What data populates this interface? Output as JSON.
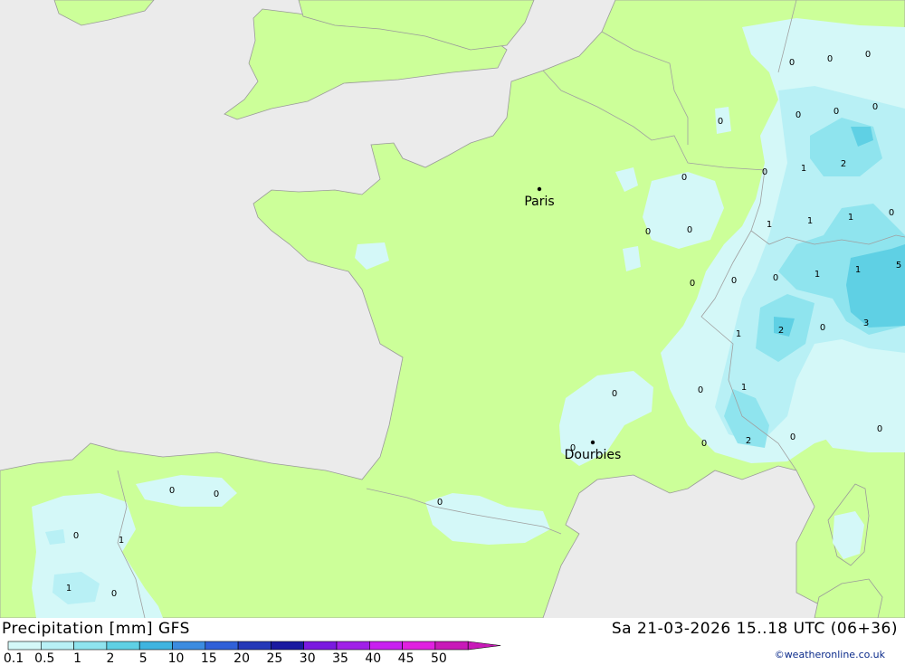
{
  "title": "Precipitation [mm] GFS",
  "valid_time": "Sa 21-03-2026 15..18 UTC (06+36)",
  "credit": "©weatheronline.co.uk",
  "colors": {
    "sea": "#ebebeb",
    "land": "#ccff99",
    "border": "#9a9a9a"
  },
  "legend": {
    "labels": [
      "0.1",
      "0.5",
      "1",
      "2",
      "5",
      "10",
      "15",
      "20",
      "25",
      "30",
      "35",
      "40",
      "45",
      "50"
    ],
    "colors": [
      "#d4f8f8",
      "#b8f0f5",
      "#8fe4ee",
      "#5fd0e4",
      "#3fb4e0",
      "#3c8ce0",
      "#3060d8",
      "#2438b8",
      "#1a1aa0",
      "#7a1ae0",
      "#a020e8",
      "#c820f0",
      "#e020e0",
      "#c81ab8"
    ]
  },
  "cities": [
    {
      "name": "Paris"
    },
    {
      "name": "Dourbies"
    }
  ],
  "values": [
    "0",
    "0",
    "0",
    "0",
    "0",
    "0",
    "2",
    "0",
    "0",
    "1",
    "1",
    "1",
    "0",
    "1",
    "1",
    "5",
    "0",
    "0",
    "0",
    "1",
    "1",
    "0",
    "2",
    "0",
    "3",
    "0",
    "1",
    "0",
    "0",
    "0",
    "2",
    "0",
    "0",
    "0",
    "0",
    "0",
    "0",
    "0",
    "0",
    "1",
    "0",
    "1"
  ]
}
